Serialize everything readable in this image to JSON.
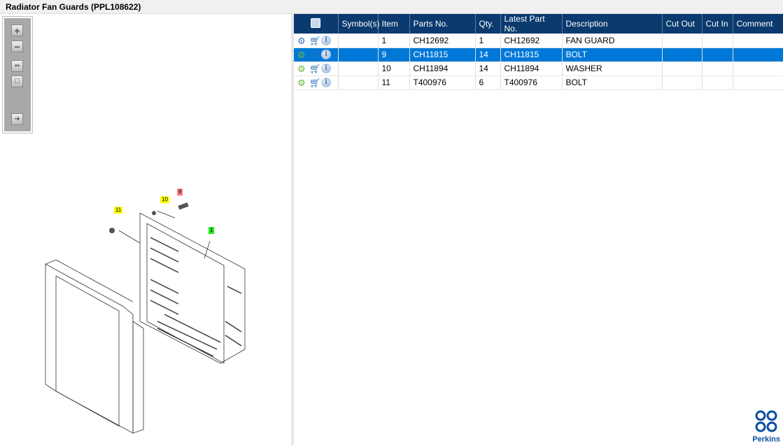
{
  "title": "Radiator Fan Guards (PPL108622)",
  "toolbox": {
    "zoom_in": "zoom-in",
    "zoom_out": "zoom-out",
    "fit": "fit-all",
    "actual": "actual-size",
    "export": "export"
  },
  "table": {
    "headers": [
      "",
      "Symbol(s)",
      "Item",
      "Parts No.",
      "Qty.",
      "Latest Part No.",
      "Description",
      "Cut Out",
      "Cut In",
      "Comment"
    ],
    "rows": [
      {
        "item": "1",
        "parts_no": "CH12692",
        "qty": "1",
        "latest": "CH12692",
        "description": "FAN GUARD",
        "selected": false
      },
      {
        "item": "9",
        "parts_no": "CH11815",
        "qty": "14",
        "latest": "CH11815",
        "description": "BOLT",
        "selected": true
      },
      {
        "item": "10",
        "parts_no": "CH11894",
        "qty": "14",
        "latest": "CH11894",
        "description": "WASHER",
        "selected": false
      },
      {
        "item": "11",
        "parts_no": "T400976",
        "qty": "6",
        "latest": "T400976",
        "description": "BOLT",
        "selected": false
      }
    ]
  },
  "callouts": {
    "c1": "1",
    "c9": "9",
    "c10": "10",
    "c11": "11"
  },
  "logo": "Perkins",
  "colors": {
    "header": "#0a3a6e",
    "selected": "#0078d7"
  }
}
